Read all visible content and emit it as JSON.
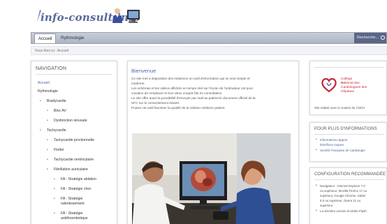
{
  "header": {
    "logo_text": "info-consult.info"
  },
  "navbar": {
    "tabs": [
      {
        "label": "Accueil"
      },
      {
        "label": "Rythmologie"
      }
    ],
    "search_label": "Recherche..."
  },
  "breadcrumb": "Vous êtes ici : Accueil",
  "sidebar": {
    "title": "NAVIGATION",
    "items": [
      {
        "label": "Accueil"
      },
      {
        "label": "Rythmologie"
      },
      {
        "label": "Bradycardie"
      },
      {
        "label": "Bloc AV"
      },
      {
        "label": "Dysfonction sinusale"
      },
      {
        "label": "Tachycardie"
      },
      {
        "label": "Tachycardie jonctionnelle"
      },
      {
        "label": "Flutter"
      },
      {
        "label": "Tachycardie ventriculaire"
      },
      {
        "label": "Fibrillation auriculaire"
      },
      {
        "label": "FA - Stratégie ablation"
      },
      {
        "label": "FA - Stratégie choc"
      },
      {
        "label": "FA - Stratégie"
      },
      {
        "label": "ralentissement"
      },
      {
        "label": "FA - Stratégie"
      },
      {
        "label": "antithrombotique"
      }
    ]
  },
  "main": {
    "title": "Bienvenue",
    "lines": [
      "Ce site met à disposition des médecins un outil d'information qui se veut simple et",
      "moderne.",
      "Les schémas et les vidéos affichés en temps réel sur l'écran de l'ordinateur ont pour",
      "vocation de remplacer le bon vieux croquis fait en consultation.",
      "Le site offre aussi la possibilité d'envoyer par mail au patient le document officiel de la",
      "SFC sur le consentement éclairé.",
      "Puisse cet outil favoriser la qualité de la relation médecin patient."
    ]
  },
  "right": {
    "cnch": {
      "line1": "Collège",
      "line2_prefix": "N",
      "line2_rest": "ational des",
      "line3": "Cardiologues des",
      "line4": "Hôpitaux",
      "caption": "Site réalisé avec le soutien du CNCH"
    },
    "info": {
      "title": "POUR PLUS D'INFORMATIONS",
      "items": [
        "Informations rapport",
        "bénéfices risques",
        "Société Française de Cardiologie"
      ]
    },
    "config": {
      "title": "CONFIGURATION RECOMMANDÉE",
      "lines": [
        "Navigateur : Internet Explorer 7.0",
        "ou supérieur, Mozilla Firefox 17 ou",
        "supérieur, Google Chrome, Safari",
        "5.0 ou supérieur, Opera 11 ou",
        "supérieur",
        "La dernière version d'Adobe Flash."
      ]
    }
  },
  "colors": {
    "accent_blue": "#4a6fae",
    "nav_dark": "#5b6786",
    "cnch_red": "#c8253a"
  }
}
